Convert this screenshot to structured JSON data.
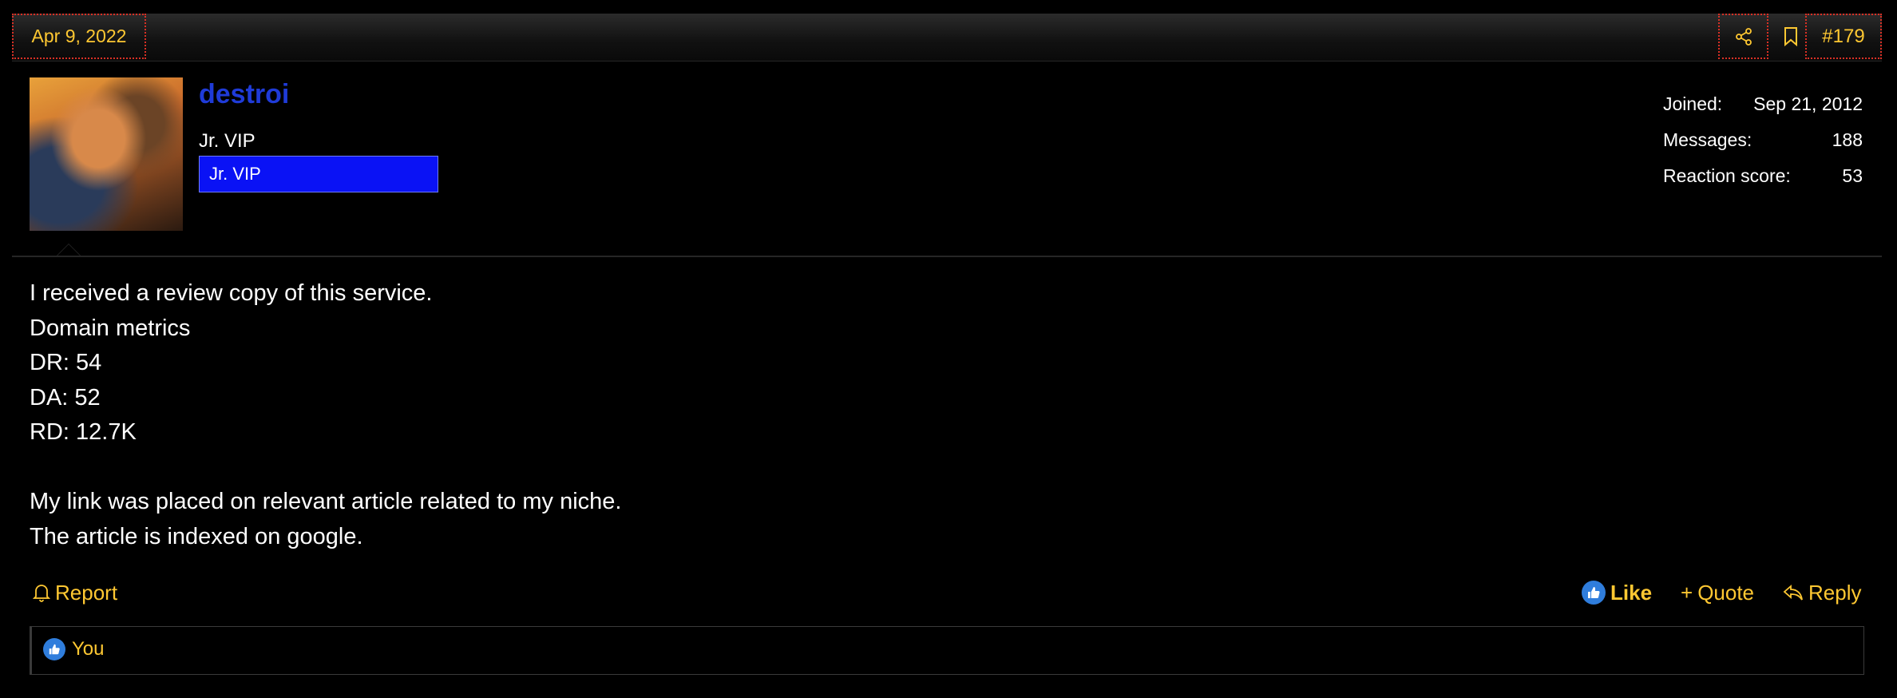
{
  "header": {
    "date": "Apr 9, 2022",
    "post_number": "#179",
    "share_icon": "share-icon",
    "bookmark_icon": "bookmark-icon"
  },
  "user": {
    "name": "destroi",
    "title": "Jr. VIP",
    "banner": "Jr. VIP",
    "stats": [
      {
        "label": "Joined:",
        "value": "Sep 21, 2012"
      },
      {
        "label": "Messages:",
        "value": "188"
      },
      {
        "label": "Reaction score:",
        "value": "53"
      }
    ]
  },
  "body": {
    "lines": [
      "I received a review copy of this service.",
      "Domain metrics",
      "DR: 54",
      "DA: 52",
      "RD: 12.7K",
      "",
      "My link was placed on relevant article related to my niche.",
      "The article is indexed on google."
    ]
  },
  "actions": {
    "report": "Report",
    "like": "Like",
    "quote": "Quote",
    "reply": "Reply"
  },
  "reactions": {
    "label": "You"
  },
  "colors": {
    "accent": "#ffc832",
    "username": "#1f3bd8",
    "banner": "#0a12f5",
    "like": "#2f7ddc"
  }
}
